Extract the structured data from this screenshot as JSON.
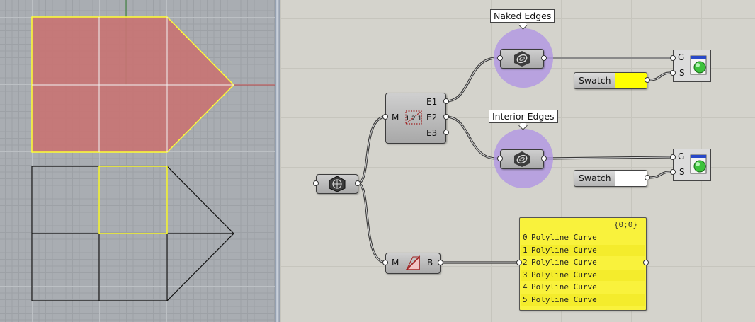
{
  "viewport": {
    "mesh_fill": "#c87474",
    "highlight": "#ffff33"
  },
  "canvas": {
    "tag_naked": "Naked  Edges",
    "tag_interior": "Interior  Edges",
    "mesh_edges": {
      "input": "M",
      "outputs": [
        "E1",
        "E2",
        "E3"
      ]
    },
    "boundary": {
      "input": "M",
      "output": "B"
    },
    "preview_1": {
      "g": "G",
      "s": "S"
    },
    "preview_2": {
      "g": "G",
      "s": "S"
    },
    "swatch_1": {
      "label": "Swatch",
      "color": "#ffff00"
    },
    "swatch_2": {
      "label": "Swatch",
      "color": "#ffffff"
    },
    "panel": {
      "header": "{0;0}",
      "rows": [
        {
          "index": "0",
          "value": "Polyline Curve"
        },
        {
          "index": "1",
          "value": "Polyline Curve"
        },
        {
          "index": "2",
          "value": "Polyline Curve"
        },
        {
          "index": "3",
          "value": "Polyline Curve"
        },
        {
          "index": "4",
          "value": "Polyline Curve"
        },
        {
          "index": "5",
          "value": "Polyline Curve"
        }
      ]
    },
    "icons": {
      "mesh_param": "mesh-param-icon",
      "mesh_edges": "mesh-edges-icon",
      "boundary": "mesh-boundary-icon",
      "edges_filter": "curve-param-icon",
      "preview": "custom-preview-icon"
    }
  }
}
